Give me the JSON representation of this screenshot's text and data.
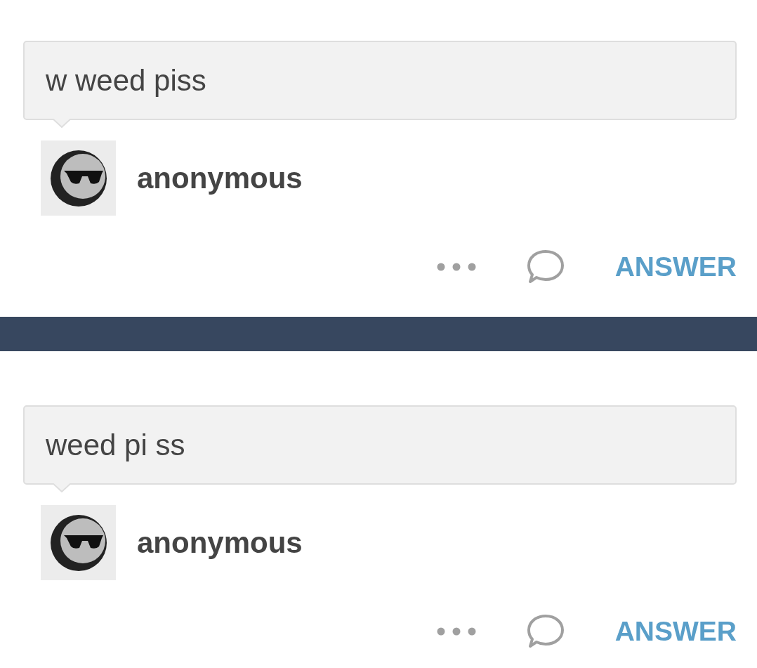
{
  "posts": [
    {
      "question": "w weed piss",
      "author": "anonymous",
      "answer_button": "ANSWER"
    },
    {
      "question": "weed pi ss",
      "author": "anonymous",
      "answer_button": "ANSWER"
    }
  ]
}
